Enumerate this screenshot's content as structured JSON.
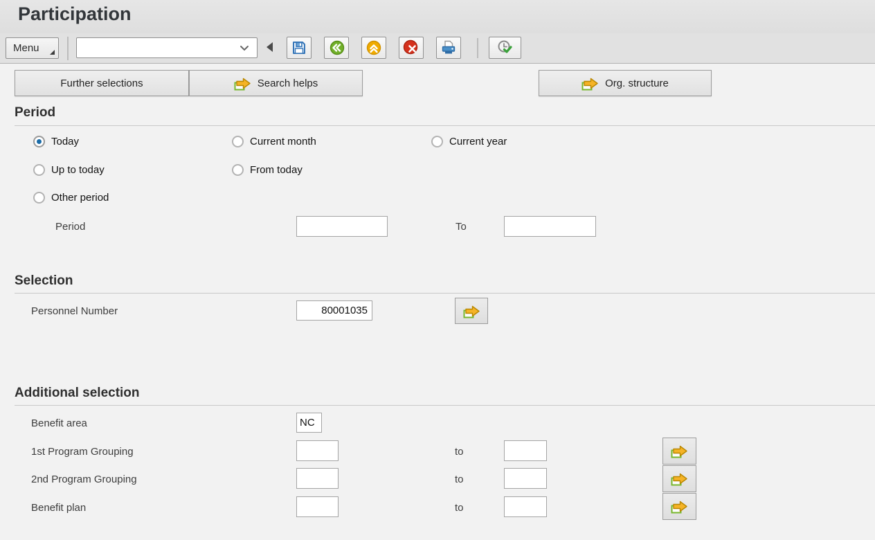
{
  "window": {
    "title": "Participation"
  },
  "toolbar": {
    "menu_label": "Menu",
    "command_field": {
      "value": "",
      "placeholder": ""
    },
    "icon_names": [
      "save-icon",
      "back-icon",
      "exit-icon",
      "cancel-icon",
      "print-icon",
      "execute-icon"
    ]
  },
  "action_buttons": {
    "further_selections": "Further selections",
    "search_helps": "Search helps",
    "org_structure": "Org. structure"
  },
  "sections": {
    "period": {
      "heading": "Period",
      "radios": [
        {
          "label": "Today",
          "selected": true
        },
        {
          "label": "Current month",
          "selected": false
        },
        {
          "label": "Current year",
          "selected": false
        },
        {
          "label": "Up to today",
          "selected": false
        },
        {
          "label": "From today",
          "selected": false
        },
        {
          "label": "Other period",
          "selected": false
        }
      ],
      "range": {
        "label": "Period",
        "from_value": "",
        "to_label": "To",
        "to_value": ""
      }
    },
    "selection": {
      "heading": "Selection",
      "personnel": {
        "label": "Personnel Number",
        "value": "80001035"
      }
    },
    "additional": {
      "heading": "Additional selection",
      "benefit_area": {
        "label": "Benefit area",
        "value": "NC"
      },
      "rows": [
        {
          "label": "1st Program Grouping",
          "from_value": "",
          "to_label": "to",
          "to_value": ""
        },
        {
          "label": "2nd Program Grouping",
          "from_value": "",
          "to_label": "to",
          "to_value": ""
        },
        {
          "label": "Benefit plan",
          "from_value": "",
          "to_label": "to",
          "to_value": ""
        }
      ]
    }
  },
  "colors": {
    "accent_green": "#72b02a",
    "accent_yellow": "#f0ab00",
    "accent_red": "#d5311d",
    "accent_blue": "#3676b8",
    "radio_selected": "#1b6ca8",
    "header_bg": "#e1e1e1",
    "content_bg": "#f2f2f2"
  }
}
